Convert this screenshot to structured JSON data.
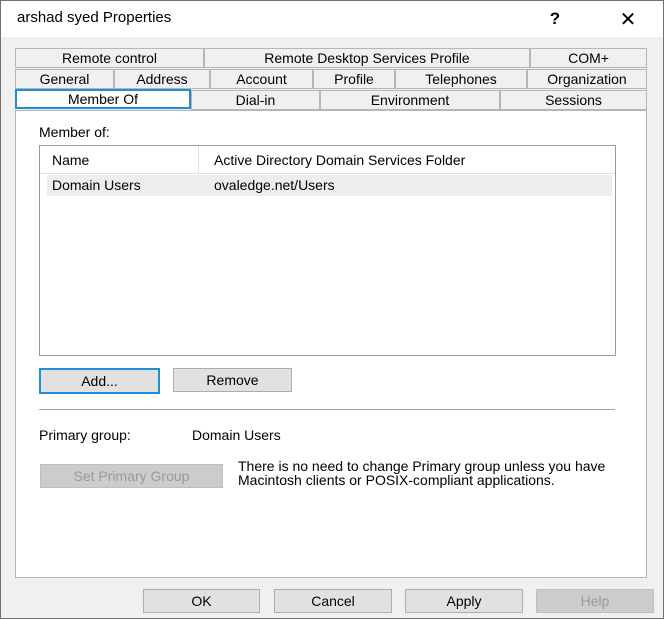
{
  "window": {
    "title": "arshad syed Properties",
    "help_label": "?",
    "close_label": "✕"
  },
  "tabs": {
    "row1": [
      "Remote control",
      "Remote Desktop Services Profile",
      "COM+"
    ],
    "row2": [
      "General",
      "Address",
      "Account",
      "Profile",
      "Telephones",
      "Organization"
    ],
    "row3": [
      "Member Of",
      "Dial-in",
      "Environment",
      "Sessions"
    ],
    "active": "Member Of"
  },
  "member_of": {
    "label": "Member of:",
    "columns": [
      "Name",
      "Active Directory Domain Services Folder"
    ],
    "rows": [
      {
        "name": "Domain Users",
        "folder": "ovaledge.net/Users"
      }
    ],
    "add_label": "Add...",
    "remove_label": "Remove"
  },
  "primary_group": {
    "label": "Primary group:",
    "value": "Domain Users",
    "set_button_label": "Set Primary Group",
    "note": "There is no need to change Primary group unless you have Macintosh clients or POSIX-compliant applications."
  },
  "footer": {
    "ok_label": "OK",
    "cancel_label": "Cancel",
    "apply_label": "Apply",
    "help_label": "Help"
  },
  "colors": {
    "accent": "#1e8fd6",
    "dialog_bg": "#f0f0f0",
    "selected_row": "#ededed"
  }
}
